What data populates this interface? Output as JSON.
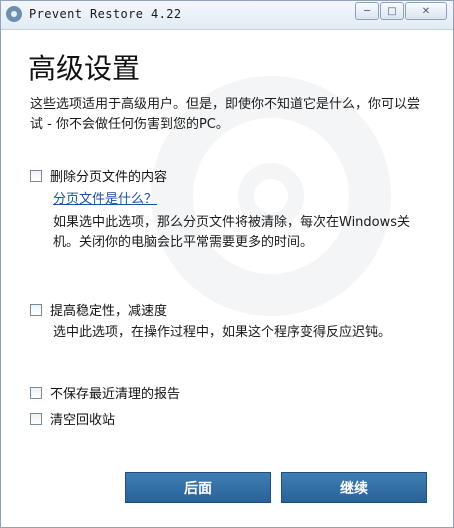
{
  "window": {
    "title": "Prevent Restore 4.22"
  },
  "heading": "高级设置",
  "intro": "这些选项适用于高级用户。但是，即使你不知道它是什么，你可以尝试 - 你不会做任何伤害到您的PC。",
  "options": {
    "delete_pagefile": {
      "label": "删除分页文件的内容",
      "checked": false,
      "help_link": "分页文件是什么？",
      "description": "如果选中此选项，那么分页文件将被清除，每次在Windows关机。关闭你的电脑会比平常需要更多的时间。"
    },
    "improve_stability": {
      "label": "提高稳定性，减速度",
      "checked": false,
      "description": "选中此选项，在操作过程中，如果这个程序变得反应迟钝。"
    },
    "no_save_report": {
      "label": "不保存最近清理的报告",
      "checked": false
    },
    "empty_recycle_bin": {
      "label": "清空回收站",
      "checked": false
    }
  },
  "buttons": {
    "back": "后面",
    "continue": "继续"
  },
  "icons": {
    "app": "prevent-restore-logo-icon",
    "minimize": "minimize-icon",
    "maximize": "maximize-icon",
    "close": "close-icon"
  }
}
